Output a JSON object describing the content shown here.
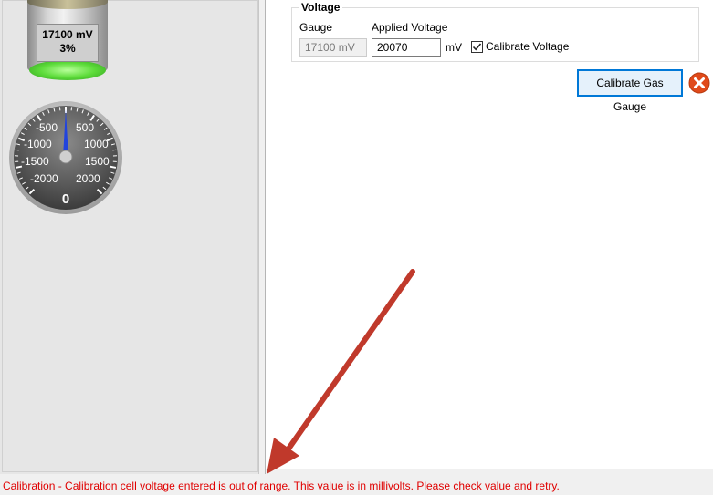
{
  "battery": {
    "voltage": "17100 mV",
    "percent": "3%"
  },
  "gauge": {
    "value": "0",
    "needle_value": 0,
    "left_ticks": [
      "-500",
      "-1000",
      "-1500",
      "-2000"
    ],
    "right_ticks": [
      "500",
      "1000",
      "1500",
      "2000"
    ]
  },
  "voltage_group": {
    "title": "Voltage",
    "gauge_label": "Gauge",
    "gauge_value": "17100 mV",
    "applied_label": "Applied Voltage",
    "applied_value": "20070",
    "unit": "mV",
    "checkbox_label": "Calibrate Voltage",
    "checkbox_checked": true
  },
  "actions": {
    "calibrate_button": "Calibrate Gas Gauge"
  },
  "status": {
    "message": "Calibration - Calibration cell voltage entered is out of range. This value is in millivolts. Please check value and retry."
  },
  "colors": {
    "status_text": "#e00000",
    "arrow": "#c0392b",
    "close": "#e04a1a",
    "needle": "#2244dd"
  }
}
